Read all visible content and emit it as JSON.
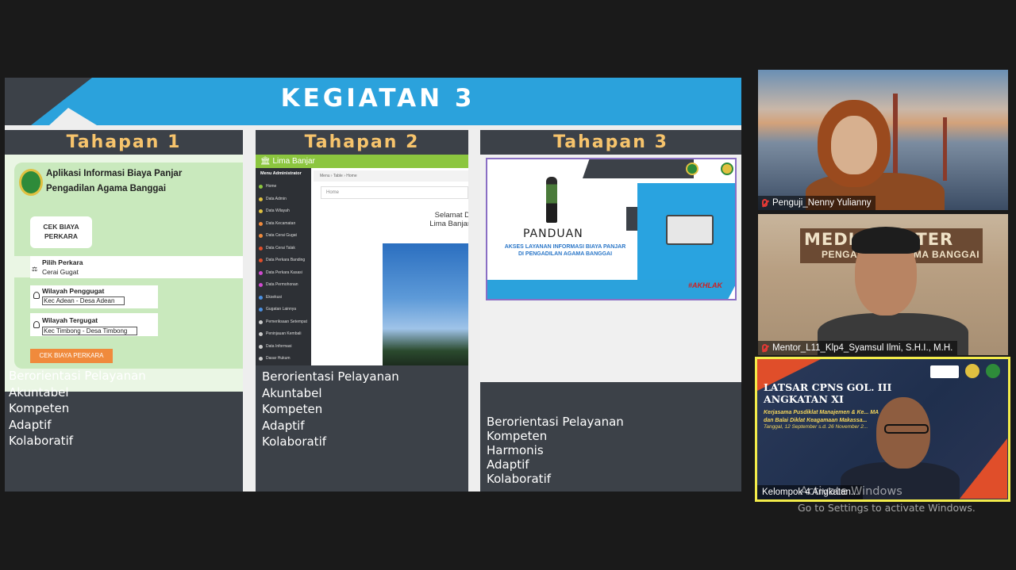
{
  "slide": {
    "title": "KEGIATAN 3",
    "panels": [
      {
        "heading": "Tahapan 1",
        "app_title_line1": "Aplikasi Informasi Biaya Panjar",
        "app_title_line2": "Pengadilan Agama Banggai",
        "cek_bubble_line1": "CEK BIAYA",
        "cek_bubble_line2": "PERKARA",
        "pilih_label": "Pilih Perkara",
        "pilih_value": "Cerai Gugat",
        "penggugat_label": "Wilayah Penggugat",
        "penggugat_value": "Kec Adean - Desa Adean",
        "tergugat_label": "Wilayah Tergugat",
        "tergugat_value": "Kec Timbong - Desa Timbong",
        "button_label": "CEK BIAYA PERKARA",
        "values": [
          "Berorientasi Pelayanan",
          "Akuntabel",
          "Kompeten",
          "Adaptif",
          "Kolaboratif"
        ]
      },
      {
        "heading": "Tahapan 2",
        "topbar_label": "Lima Banjar",
        "menu_title": "Menu Administrator",
        "menu_items": [
          "Home",
          "Data Admin",
          "Data Wilayah",
          "Data Kecamatan",
          "Data Cerai Gugat",
          "Data Cerai Talak",
          "Data Perkara Banding",
          "Data Perkara Kasasi",
          "Data Permohonan",
          "Eksekusi",
          "Gugatan Lainnya",
          "Pemeriksaan Setempat",
          "Peninjauan Kembali",
          "Data Informasi",
          "Dasar Hukum"
        ],
        "breadcrumb": "Menu  ›  Table  ›  Home",
        "home_label": "Home",
        "welcome_line1": "Selamat D",
        "welcome_line2": "Lima Banjar",
        "values": [
          "Berorientasi Pelayanan",
          "Akuntabel",
          "Kompeten",
          "Adaptif",
          "Kolaboratif"
        ]
      },
      {
        "heading": "Tahapan 3",
        "card_title": "PANDUAN",
        "card_sub_line1": "AKSES LAYANAN INFORMASI BIAYA PANJAR",
        "card_sub_line2": "DI PENGADILAN AGAMA BANGGAI",
        "card_tag": "#AKHLAK",
        "values": [
          "Berorientasi Pelayanan",
          "Kompeten",
          "Harmonis",
          "Adaptif",
          "Kolaboratif"
        ]
      }
    ]
  },
  "participants": [
    {
      "name": "Penguji_Nenny Yulianny",
      "muted": true
    },
    {
      "name": "Mentor_L11_Klp4_Syamsul Ilmi, S.H.I., M.H.",
      "muted": true,
      "sign_line1": "MEDIA CENTER",
      "sign_line2": "PENGADILAN AGAMA BANGGAI"
    },
    {
      "name": "Kelompok 4 Angkatan...",
      "muted": false,
      "active_speaker": true,
      "bg_title_line1": "LATSAR CPNS GOL. III",
      "bg_title_line2": "ANGKATAN XI",
      "bg_sub_line1": "Kerjasama Pusdiklat Manajemen & Ke... MA",
      "bg_sub_line2": "dan Balai Diklat Keagamaan Makassa...",
      "bg_date": "Tanggal, 12 September s.d. 26 November 2..."
    }
  ],
  "windows_watermark": {
    "line1": "Activate Windows",
    "line2": "Go to Settings to activate Windows."
  },
  "colors": {
    "background": "#1a1a1a",
    "slide_blue": "#2ba2dc",
    "slide_dark": "#3c4148",
    "heading_gold": "#f7c46c",
    "active_speaker_border": "#f3ec4a",
    "muted_red": "#e53935"
  }
}
